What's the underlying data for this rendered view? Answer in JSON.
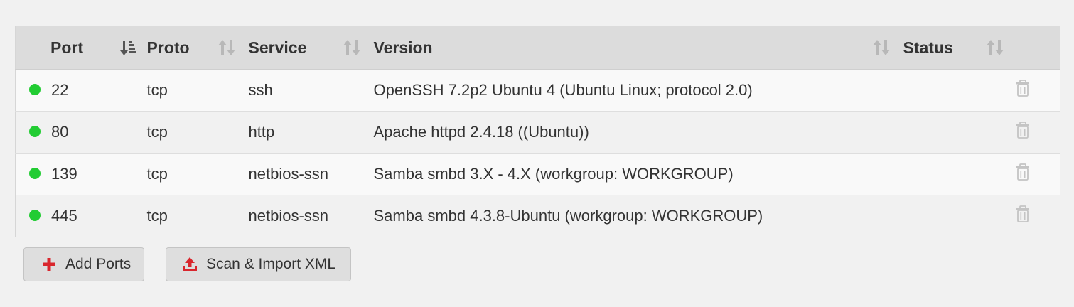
{
  "table": {
    "columns": [
      {
        "label": "Port",
        "sort": "sort-active-icon"
      },
      {
        "label": "Proto",
        "sort": "sort-icon"
      },
      {
        "label": "Service",
        "sort": "sort-icon"
      },
      {
        "label": "Version",
        "sort": "sort-icon"
      },
      {
        "label": "Status",
        "sort": "sort-icon"
      }
    ],
    "rows": [
      {
        "status_color": "#22cc33",
        "port": "22",
        "proto": "tcp",
        "service": "ssh",
        "version": "OpenSSH 7.2p2 Ubuntu 4 (Ubuntu Linux; protocol 2.0)",
        "status": ""
      },
      {
        "status_color": "#22cc33",
        "port": "80",
        "proto": "tcp",
        "service": "http",
        "version": "Apache httpd 2.4.18 ((Ubuntu))",
        "status": ""
      },
      {
        "status_color": "#22cc33",
        "port": "139",
        "proto": "tcp",
        "service": "netbios-ssn",
        "version": "Samba smbd 3.X - 4.X (workgroup: WORKGROUP)",
        "status": ""
      },
      {
        "status_color": "#22cc33",
        "port": "445",
        "proto": "tcp",
        "service": "netbios-ssn",
        "version": "Samba smbd 4.3.8-Ubuntu (workgroup: WORKGROUP)",
        "status": ""
      }
    ]
  },
  "actions": {
    "add_ports": {
      "label": "Add Ports",
      "icon": "plus-icon",
      "icon_color": "#d9262d"
    },
    "scan_import": {
      "label": "Scan & Import XML",
      "icon": "upload-icon",
      "icon_color": "#d9262d"
    }
  },
  "colors": {
    "header_bg": "#dcdcdc",
    "status_up": "#22cc33",
    "accent": "#d9262d"
  }
}
